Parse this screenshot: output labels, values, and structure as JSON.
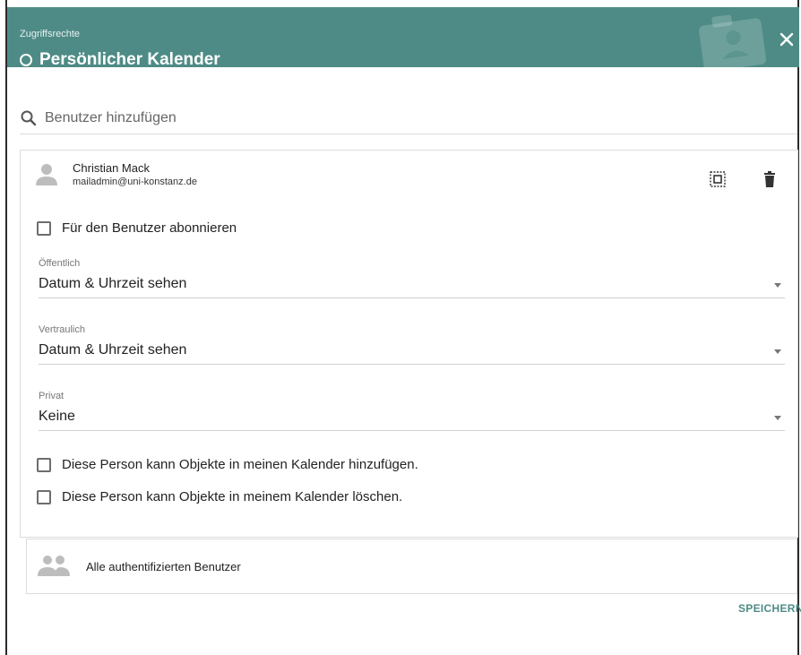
{
  "header": {
    "subtitle": "Zugriffsrechte",
    "title": "Persönlicher Kalender"
  },
  "search": {
    "placeholder": "Benutzer hinzufügen"
  },
  "user": {
    "name": "Christian Mack",
    "email": "mailadmin@uni-konstanz.de",
    "subscribe_label": "Für den Benutzer abonnieren",
    "subscribe_checked": false,
    "fields": [
      {
        "label": "Öffentlich",
        "value": "Datum & Uhrzeit sehen"
      },
      {
        "label": "Vertraulich",
        "value": "Datum & Uhrzeit sehen"
      },
      {
        "label": "Privat",
        "value": "Keine"
      }
    ],
    "can_add_label": "Diese Person kann Objekte in meinen Kalender hinzufügen.",
    "can_add_checked": false,
    "can_delete_label": "Diese Person kann Objekte in meinem Kalender löschen.",
    "can_delete_checked": false
  },
  "group": {
    "name": "Alle authentifizierten Benutzer"
  },
  "footer": {
    "save_label": "SPEICHERN"
  },
  "colors": {
    "header_bg": "#4e8b86",
    "accent": "#4e8b86"
  },
  "icons": {
    "close": "close-icon",
    "search": "search-icon",
    "avatar": "person-icon",
    "select_all": "select-all-icon",
    "delete": "trash-icon",
    "group": "people-icon"
  }
}
